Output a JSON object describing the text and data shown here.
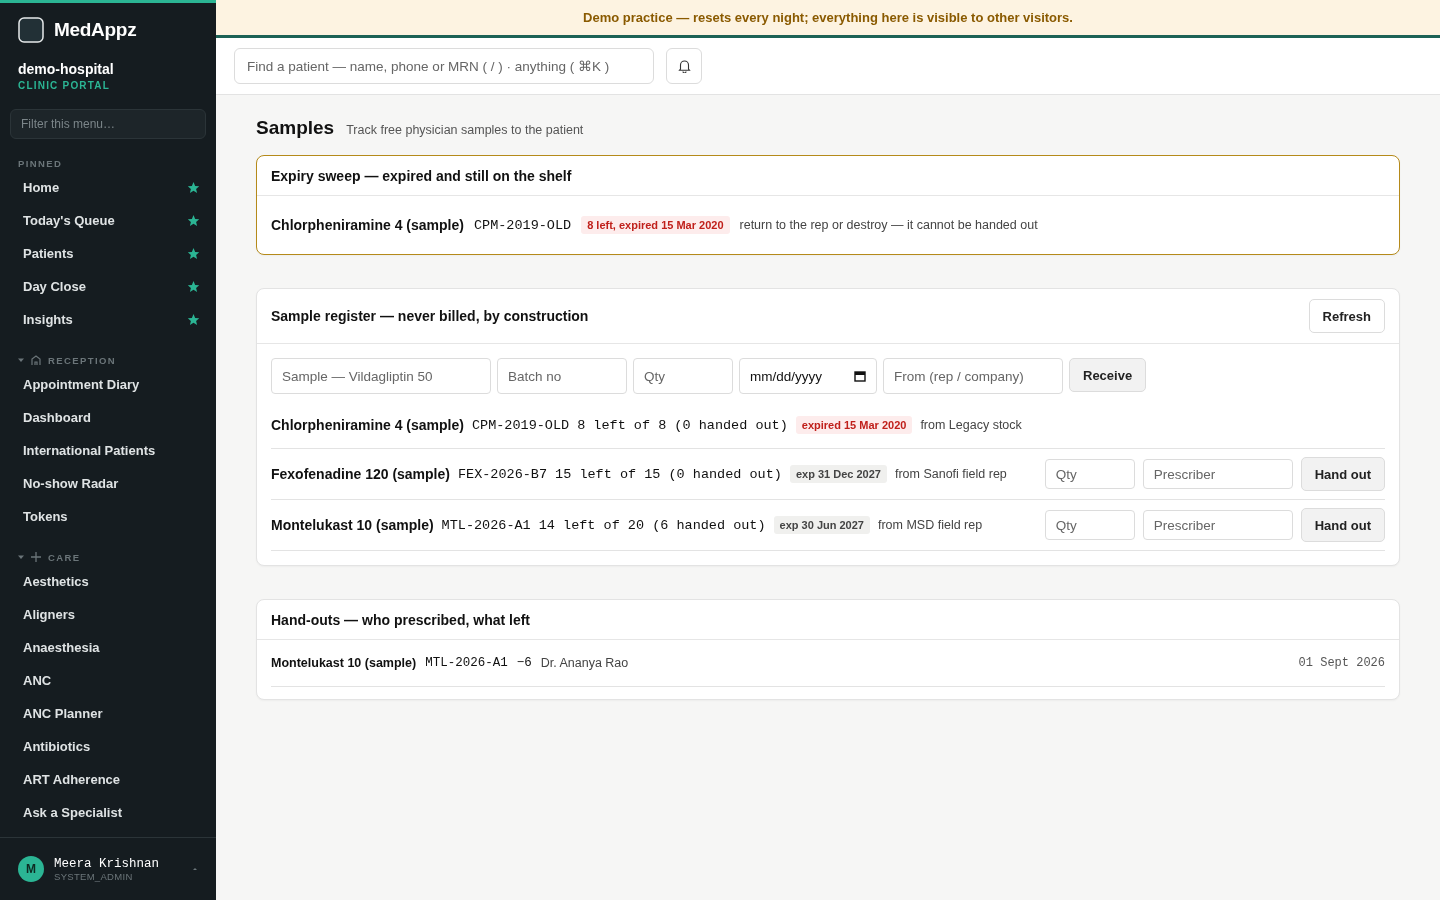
{
  "banner": "Demo practice — resets every night; everything here is visible to other visitors.",
  "sidebar": {
    "brand": "MedAppz",
    "org": "demo-hospital",
    "portal": "CLINIC PORTAL",
    "filter_placeholder": "Filter this menu…",
    "sections": [
      {
        "kind": "pinned",
        "title": "PINNED",
        "items": [
          {
            "label": "Home",
            "pinned": true
          },
          {
            "label": "Today's Queue",
            "pinned": true
          },
          {
            "label": "Patients",
            "pinned": true
          },
          {
            "label": "Day Close",
            "pinned": true
          },
          {
            "label": "Insights",
            "pinned": true
          }
        ]
      },
      {
        "kind": "reception",
        "title": "RECEPTION",
        "expanded": true,
        "items": [
          {
            "label": "Appointment Diary",
            "pinned": false
          },
          {
            "label": "Dashboard",
            "pinned": false
          },
          {
            "label": "International Patients",
            "pinned": false
          },
          {
            "label": "No-show Radar",
            "pinned": false
          },
          {
            "label": "Tokens",
            "pinned": false
          }
        ]
      },
      {
        "kind": "care",
        "title": "CARE",
        "expanded": true,
        "items": [
          {
            "label": "Aesthetics",
            "pinned": false
          },
          {
            "label": "Aligners",
            "pinned": false
          },
          {
            "label": "Anaesthesia",
            "pinned": false
          },
          {
            "label": "ANC",
            "pinned": false
          },
          {
            "label": "ANC Planner",
            "pinned": false
          },
          {
            "label": "Antibiotics",
            "pinned": false
          },
          {
            "label": "ART Adherence",
            "pinned": false
          },
          {
            "label": "Ask a Specialist",
            "pinned": false
          }
        ]
      }
    ],
    "user": {
      "initial": "M",
      "name": "Meera Krishnan",
      "role": "SYSTEM_ADMIN"
    }
  },
  "search": {
    "placeholder": "Find a patient — name, phone or MRN ( / ) · anything ( ⌘K )"
  },
  "page": {
    "title": "Samples",
    "subtitle": "Track free physician samples to the patient"
  },
  "expiry": {
    "title": "Expiry sweep — expired and still on the shelf",
    "rows": [
      {
        "name": "Chlorpheniramine 4 (sample)",
        "batch": "CPM-2019-OLD",
        "badge": "8 left, expired 15 Mar 2020",
        "note": "return to the rep or destroy — it cannot be handed out"
      }
    ]
  },
  "register": {
    "title": "Sample register — never billed, by construction",
    "refresh": "Refresh",
    "form": {
      "sample": {
        "placeholder": "Sample — Vildagliptin 50"
      },
      "batch": {
        "placeholder": "Batch no"
      },
      "qty": {
        "placeholder": "Qty"
      },
      "date": "mm/dd/yyyy",
      "from": {
        "placeholder": "From (rep / company)"
      },
      "button": "Receive"
    },
    "rows": [
      {
        "name": "Chlorpheniramine 4 (sample)",
        "batch": "CPM-2019-OLD",
        "stock": "8 left of 8 (0 handed out)",
        "badge": "expired 15 Mar 2020",
        "expired": true,
        "source": "from Legacy stock"
      },
      {
        "name": "Fexofenadine 120 (sample)",
        "batch": "FEX-2026-B7",
        "stock": "15 left of 15 (0 handed out)",
        "badge": "exp 31 Dec 2027",
        "expired": false,
        "source": "from Sanofi field rep",
        "handout": {
          "qty": {
            "placeholder": "Qty"
          },
          "prescriber": {
            "placeholder": "Prescriber"
          },
          "button": "Hand out"
        }
      },
      {
        "name": "Montelukast 10 (sample)",
        "batch": "MTL-2026-A1",
        "stock": "14 left of 20 (6 handed out)",
        "badge": "exp 30 Jun 2027",
        "expired": false,
        "source": "from MSD field rep",
        "handout": {
          "qty": {
            "placeholder": "Qty"
          },
          "prescriber": {
            "placeholder": "Prescriber"
          },
          "button": "Hand out"
        }
      }
    ]
  },
  "handouts": {
    "title": "Hand-outs — who prescribed, what left",
    "rows": [
      {
        "name": "Montelukast 10 (sample)",
        "batch": "MTL-2026-A1",
        "qty": "−6",
        "prescriber": "Dr. Ananya Rao",
        "date": "01 Sept 2026"
      }
    ]
  }
}
